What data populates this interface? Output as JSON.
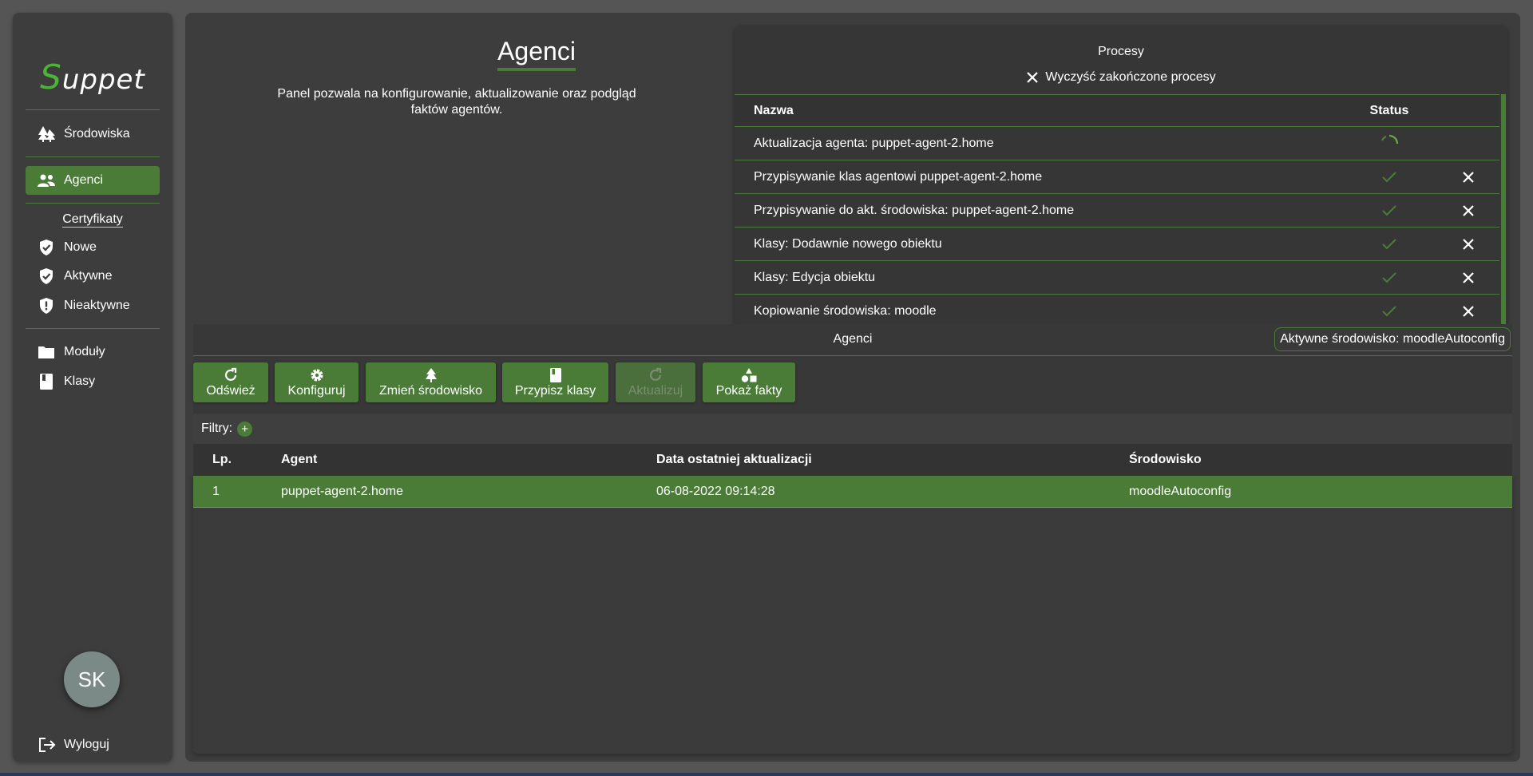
{
  "app": {
    "logo_initial": "S",
    "logo_rest": "uppet"
  },
  "sidebar": {
    "items": [
      {
        "label": "Środowiska",
        "icon": "trees-icon"
      },
      {
        "label": "Agenci",
        "icon": "people-icon"
      }
    ],
    "cert_section": "Certyfikaty",
    "cert_items": [
      {
        "label": "Nowe",
        "icon": "shield-check-icon"
      },
      {
        "label": "Aktywne",
        "icon": "shield-check-icon"
      },
      {
        "label": "Nieaktywne",
        "icon": "shield-alert-icon"
      }
    ],
    "other_items": [
      {
        "label": "Moduły",
        "icon": "folder-icon"
      },
      {
        "label": "Klasy",
        "icon": "book-icon"
      }
    ],
    "avatar": "SK",
    "logout": "Wyloguj"
  },
  "page": {
    "title": "Agenci",
    "description": "Panel pozwala na konfigurowanie, aktualizowanie oraz podgląd faktów agentów."
  },
  "processes": {
    "title": "Procesy",
    "clear_label": "Wyczyść zakończone procesy",
    "columns": [
      "Nazwa",
      "Status"
    ],
    "rows": [
      {
        "name": "Aktualizacja agenta: puppet-agent-2.home",
        "status": "running"
      },
      {
        "name": "Przypisywanie klas agentowi puppet-agent-2.home",
        "status": "done"
      },
      {
        "name": "Przypisywanie do akt. środowiska: puppet-agent-2.home",
        "status": "done"
      },
      {
        "name": "Klasy: Dodawnie nowego obiektu",
        "status": "done"
      },
      {
        "name": "Klasy: Edycja obiektu",
        "status": "done"
      },
      {
        "name": "Kopiowanie środowiska: moodle",
        "status": "done"
      }
    ]
  },
  "agents": {
    "title": "Agenci",
    "active_env": "Aktywne środowisko: moodleAutoconfig",
    "toolbar": {
      "refresh": "Odśwież",
      "configure": "Konfiguruj",
      "change_env": "Zmień środowisko",
      "assign_classes": "Przypisz klasy",
      "update": "Aktualizuj",
      "show_facts": "Pokaż fakty"
    },
    "filters_label": "Filtry:",
    "filters_add": "+",
    "columns": [
      "Lp.",
      "Agent",
      "Data ostatniej aktualizacji",
      "Środowisko"
    ],
    "rows": [
      {
        "lp": "1",
        "agent": "puppet-agent-2.home",
        "date": "06-08-2022 09:14:28",
        "env": "moodleAutoconfig"
      }
    ]
  },
  "colors": {
    "accent": "#4a7c38",
    "logo_accent": "#4fb33b",
    "panel": "#3d3d3d",
    "background": "#555555"
  }
}
